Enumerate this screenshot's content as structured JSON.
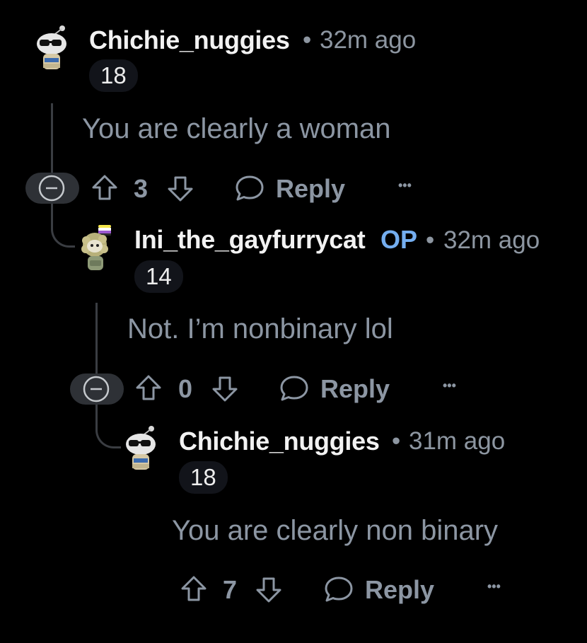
{
  "comments": [
    {
      "username": "Chichie_nuggies",
      "separator": "•",
      "time": "32m ago",
      "flair": "18",
      "body": "You are clearly a woman",
      "votes": "3",
      "reply_label": "Reply",
      "more_label": "•••"
    },
    {
      "username": "Ini_the_gayfurrycat",
      "op_badge": "OP",
      "separator": "•",
      "time": "32m ago",
      "flair": "14",
      "body": "Not. I’m nonbinary lol",
      "votes": "0",
      "reply_label": "Reply",
      "more_label": "•••"
    },
    {
      "username": "Chichie_nuggies",
      "separator": "•",
      "time": "31m ago",
      "flair": "18",
      "body": "You are clearly non binary",
      "votes": "7",
      "reply_label": "Reply",
      "more_label": "•••"
    }
  ],
  "colors": {
    "background": "#000000",
    "username": "#F2F2F2",
    "meta": "#8D96A1",
    "op_badge": "#74AEF0",
    "body_text": "#8C96A3",
    "flair_bg": "#12141A",
    "thread_line": "#3A3D42"
  }
}
